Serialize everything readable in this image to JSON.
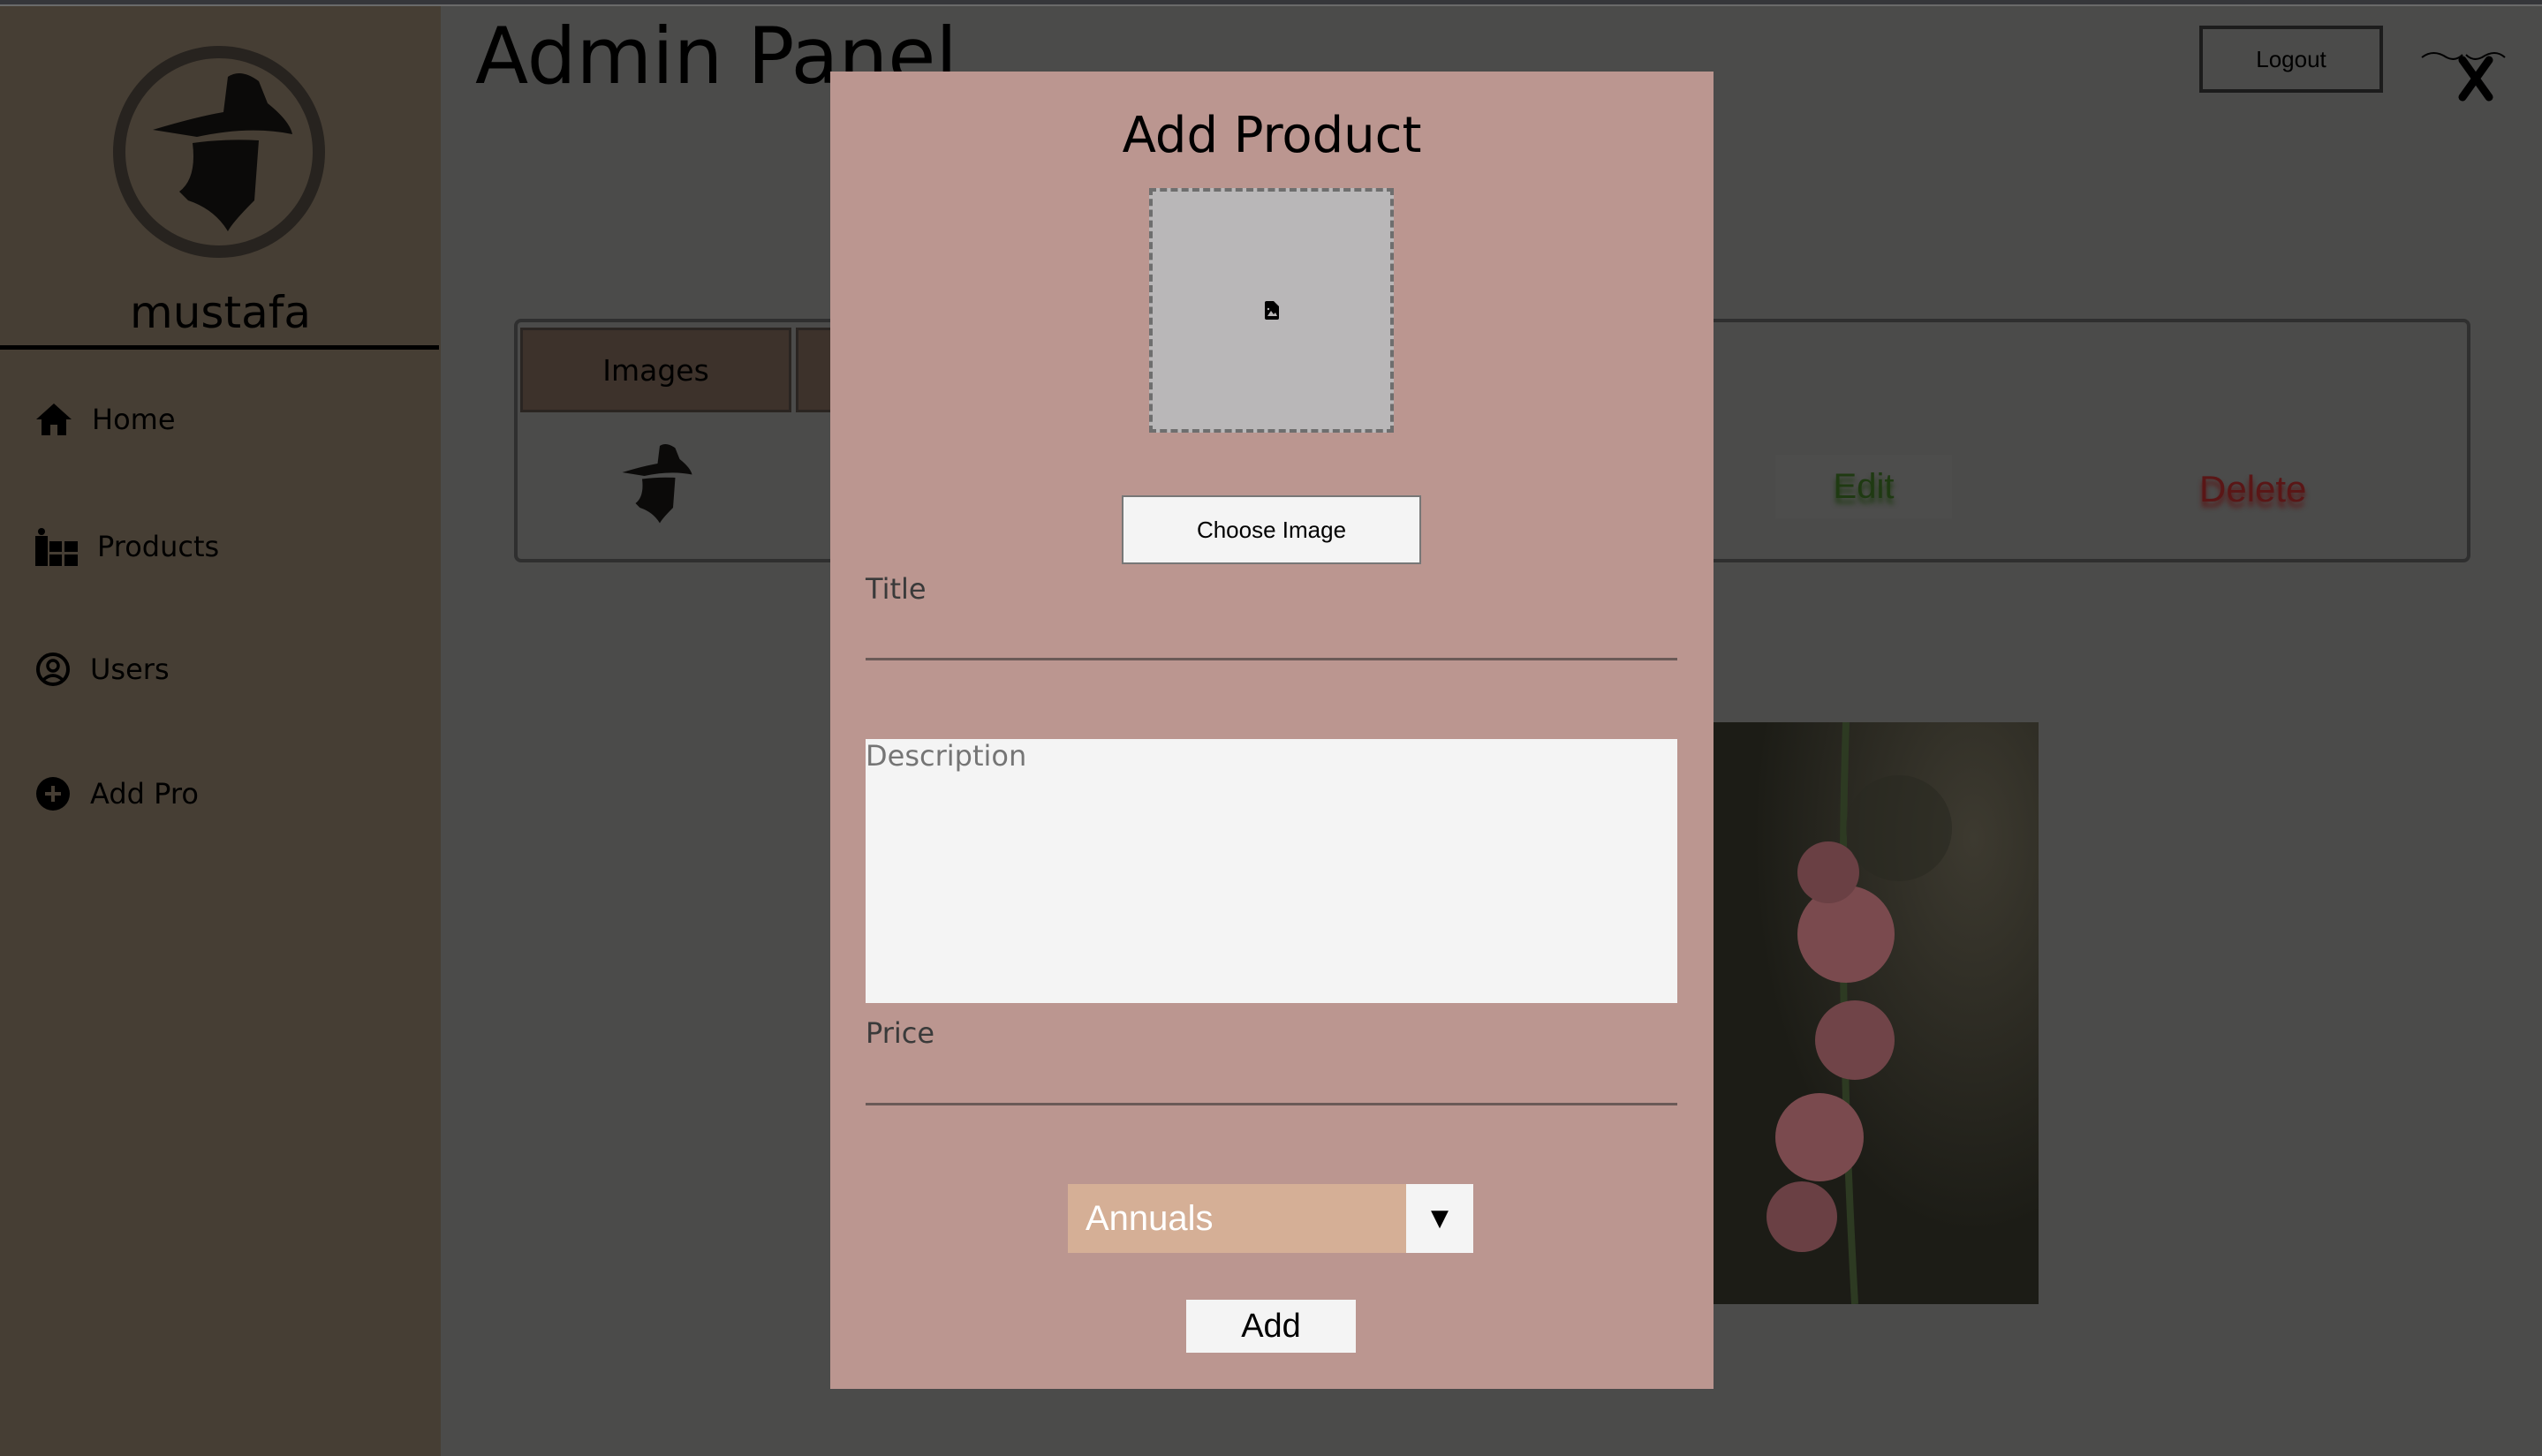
{
  "sidebar": {
    "username": "mustafa",
    "items": [
      {
        "label": "Home",
        "icon": "home-icon"
      },
      {
        "label": "Products",
        "icon": "gifts-icon"
      },
      {
        "label": "Users",
        "icon": "user-circle-icon"
      },
      {
        "label": "Add Pro",
        "icon": "plus-circle-icon"
      }
    ]
  },
  "header": {
    "title": "Admin Panel",
    "logout_label": "Logout"
  },
  "table": {
    "columns": [
      "Images"
    ],
    "row": {
      "edit_label": "Edit",
      "delete_label": "Delete"
    }
  },
  "modal": {
    "title": "Add Product",
    "choose_image_label": "Choose Image",
    "title_label": "Title",
    "title_value": "",
    "description_placeholder": "Description",
    "price_label": "Price",
    "price_value": "",
    "category_selected": "Annuals",
    "add_label": "Add"
  },
  "colors": {
    "modal_bg": "#bb9690",
    "select_bg": "#d5af96",
    "edit": "#1f3a12",
    "delete": "#5a1616"
  }
}
